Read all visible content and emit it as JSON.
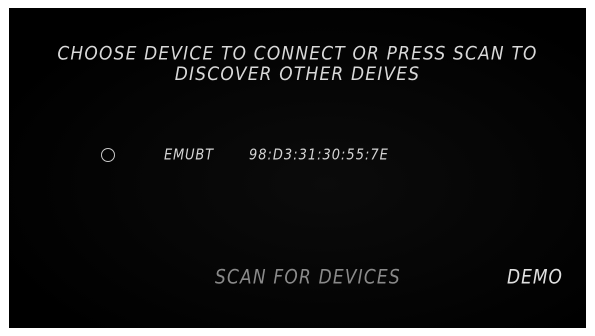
{
  "header": {
    "line1": "CHOOSE DEVICE TO CONNECT OR PRESS SCAN TO",
    "line2": "DISCOVER OTHER DEIVES"
  },
  "devices": [
    {
      "name": "EMUBT",
      "mac": "98:D3:31:30:55:7E",
      "selected": false
    }
  ],
  "actions": {
    "scan_label": "SCAN FOR DEVICES",
    "demo_label": "DEMO"
  },
  "colors": {
    "background": "#000000",
    "text": "#d9d9d9",
    "muted": "#8a8a8a",
    "frame": "#ffffff"
  }
}
